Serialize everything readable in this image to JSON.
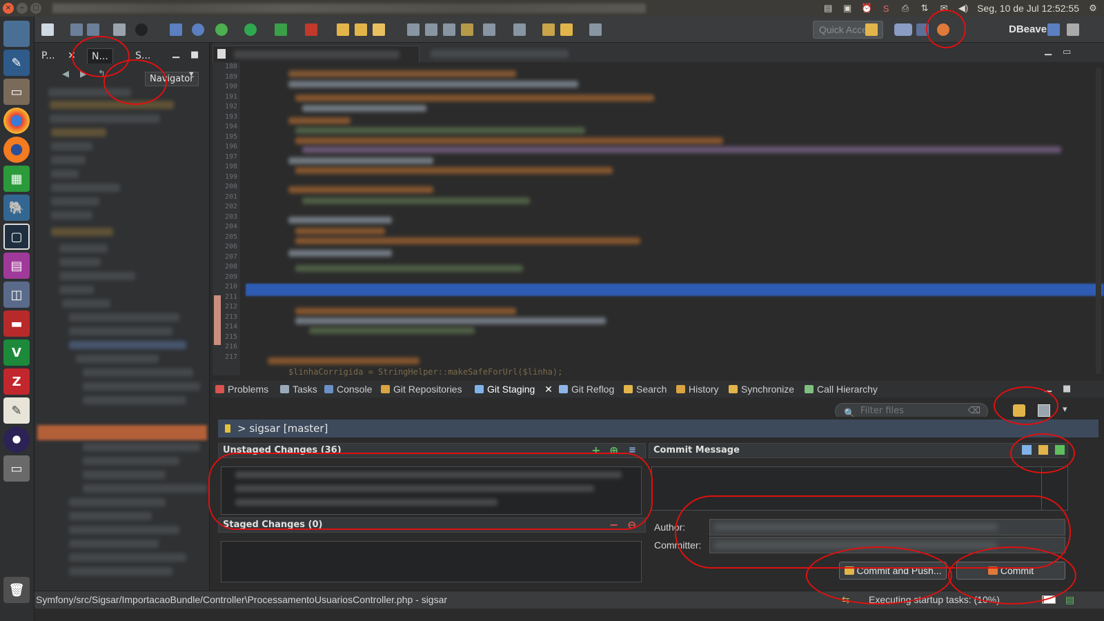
{
  "system_bar": {
    "clock": "Seg, 10 de Jul 12:52:55",
    "tray_icons": [
      "clipboard-icon",
      "screen-icon",
      "alarm-icon",
      "skype-icon",
      "printer-icon",
      "network-icon",
      "mail-icon",
      "volume-icon",
      "settings-icon"
    ]
  },
  "launcher": {
    "apps": [
      "workspace-icon",
      "pencil-app-icon",
      "files-app-icon",
      "chrome-icon",
      "firefox-icon",
      "spreadsheet-icon",
      "postgres-icon",
      "dbeaver-icon",
      "video-app-icon",
      "remote-desktop-icon",
      "terminal-app-icon",
      "vim-icon",
      "filezilla-icon",
      "text-editor-icon",
      "eclipse-icon",
      "drive-icon",
      "trash-icon"
    ]
  },
  "toolbar": {
    "quick_access": "Quick Access",
    "perspective": "DBeaver"
  },
  "left_panel": {
    "tabs": [
      {
        "label": "P...",
        "close": "✕"
      },
      {
        "label": "N...",
        "close": ""
      },
      {
        "label": "S...",
        "close": ""
      }
    ],
    "tooltip": "Navigator"
  },
  "editor": {
    "line_numbers": [
      "188",
      "189",
      "190",
      "191",
      "192",
      "193",
      "194",
      "195",
      "196",
      "197",
      "198",
      "199",
      "200",
      "201",
      "202",
      "203",
      "204",
      "205",
      "206",
      "207",
      "208",
      "209",
      "210",
      "211",
      "212",
      "213",
      "214",
      "215",
      "216",
      "217"
    ],
    "last_line_code": "$linhaCorrigida = StringHelper::makeSafeForUrl($linha);"
  },
  "views": {
    "tabs": [
      {
        "label": "Problems",
        "icon_color": "#d9534f"
      },
      {
        "label": "Tasks",
        "icon_color": "#9aa9b8"
      },
      {
        "label": "Console",
        "icon_color": "#6b8fc7"
      },
      {
        "label": "Git Repositories",
        "icon_color": "#d9a441"
      },
      {
        "label": "Git Staging",
        "icon_color": "#7fb3e8",
        "close": "✕"
      },
      {
        "label": "Git Reflog",
        "icon_color": "#8fb4e6"
      },
      {
        "label": "Search",
        "icon_color": "#e2b54a"
      },
      {
        "label": "History",
        "icon_color": "#d9a441"
      },
      {
        "label": "Synchronize",
        "icon_color": "#e2b54a"
      },
      {
        "label": "Call Hierarchy",
        "icon_color": "#7fbf7f"
      }
    ],
    "filter_placeholder": "Filter files"
  },
  "staging": {
    "repo": "> sigsar [master]",
    "unstaged_header": "Unstaged Changes (36)",
    "staged_header": "Staged Changes (0)",
    "commit_message_header": "Commit Message",
    "author_label": "Author:",
    "committer_label": "Committer:",
    "commit_and_push": "Commit and Push...",
    "commit": "Commit"
  },
  "statusbar": {
    "path": "Symfony/src/Sigsar/ImportacaoBundle/Controller\\ProcessamentoUsuariosController.php - sigsar",
    "task": "Executing startup tasks: (10%)",
    "progress": 0.1
  }
}
